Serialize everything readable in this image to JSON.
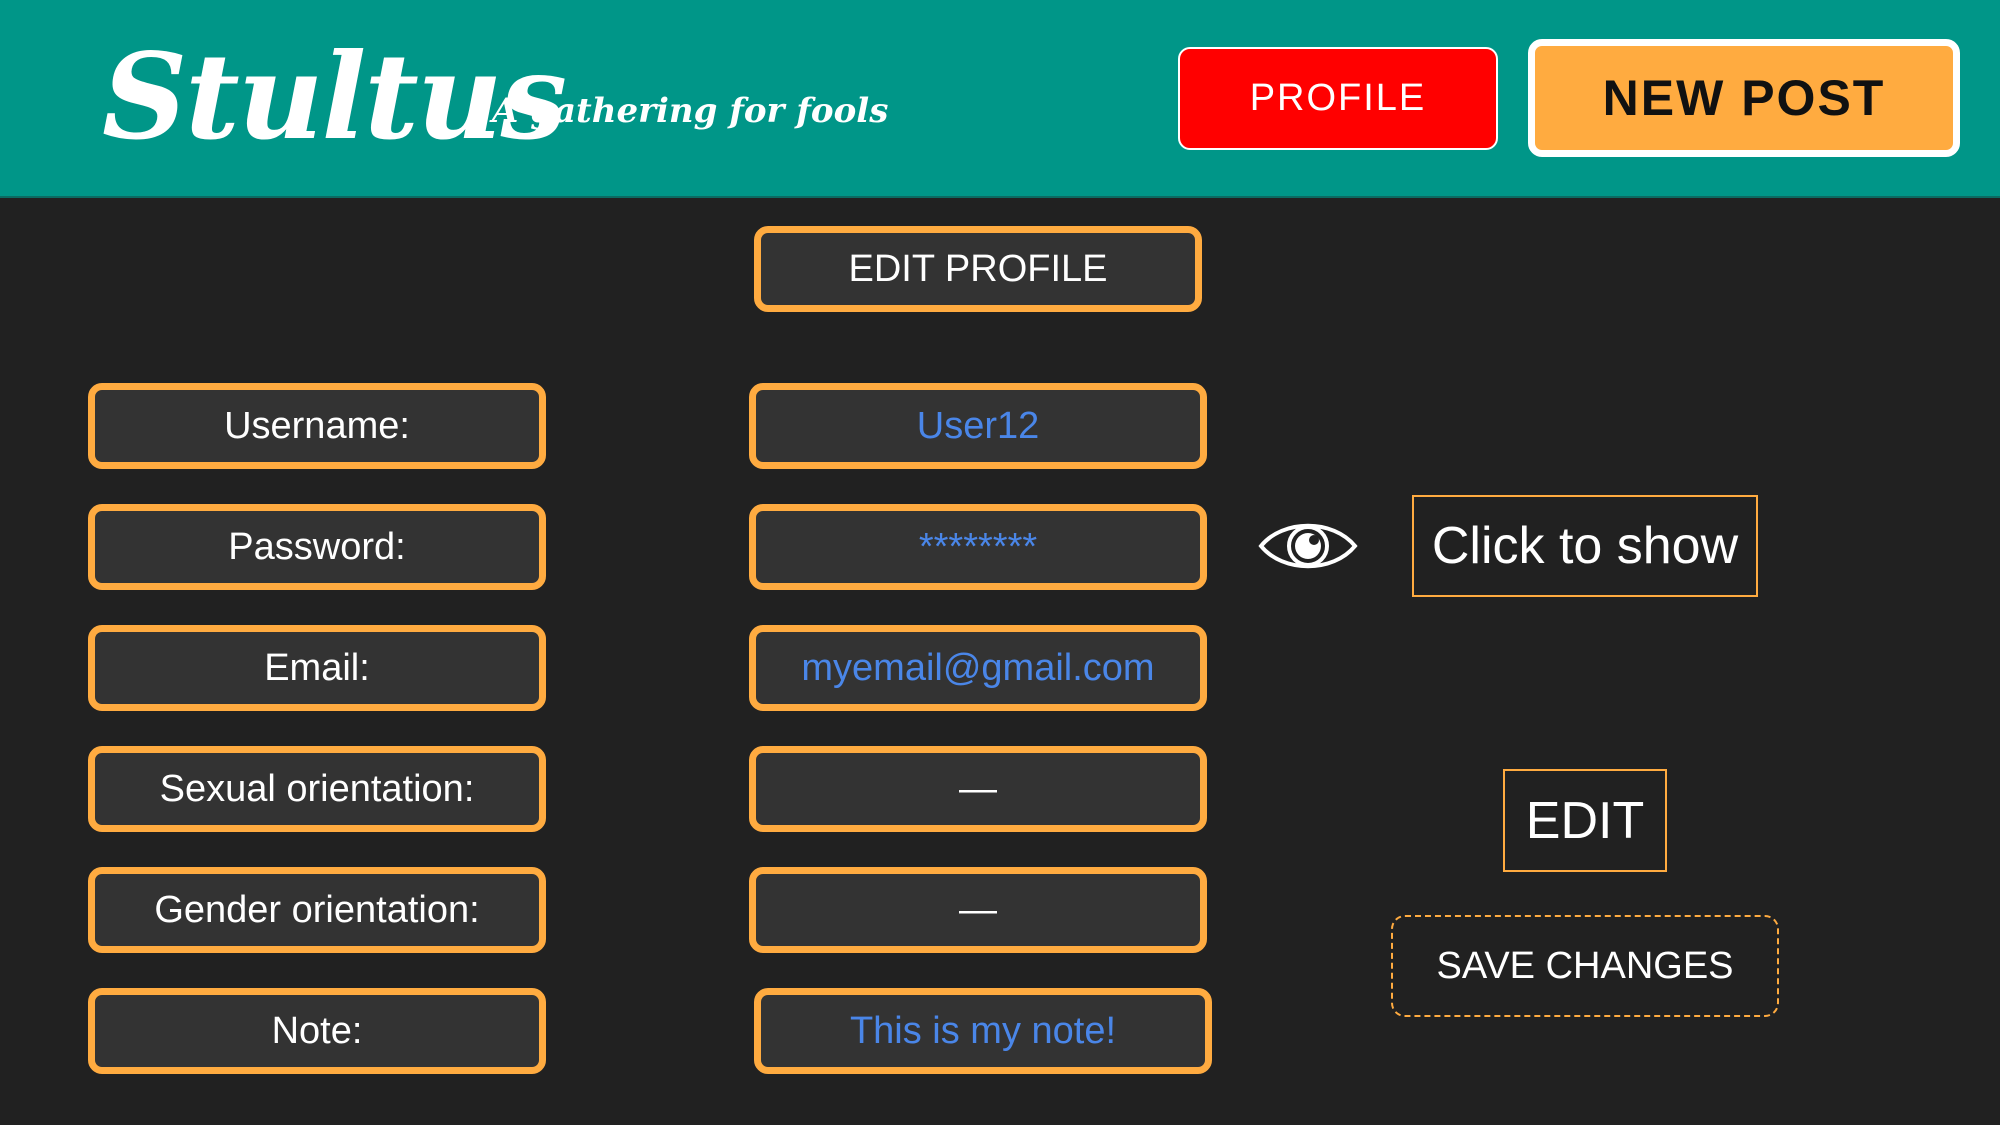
{
  "header": {
    "logo": "Stultus",
    "tagline": "A gathering for fools",
    "profile_label": "PROFILE",
    "new_post_label": "NEW POST"
  },
  "edit_profile_label": "EDIT PROFILE",
  "fields": [
    {
      "label": "Username:",
      "value": "User12"
    },
    {
      "label": "Password:",
      "value": "********"
    },
    {
      "label": "Email:",
      "value": "myemail@gmail.com"
    },
    {
      "label": "Sexual orientation:",
      "value": "—"
    },
    {
      "label": "Gender orientation:",
      "value": "—"
    },
    {
      "label": "Note:",
      "value": "This is my note!"
    }
  ],
  "show_password_label": "Click to show",
  "edit_label": "EDIT",
  "save_changes_label": "SAVE CHANGES",
  "icons": {
    "eye": "eye-icon"
  },
  "colors": {
    "header_bg": "#009688",
    "page_bg": "#212121",
    "accent": "#ffab40",
    "profile_button": "#ff0000",
    "value_text": "#4a86e8"
  }
}
